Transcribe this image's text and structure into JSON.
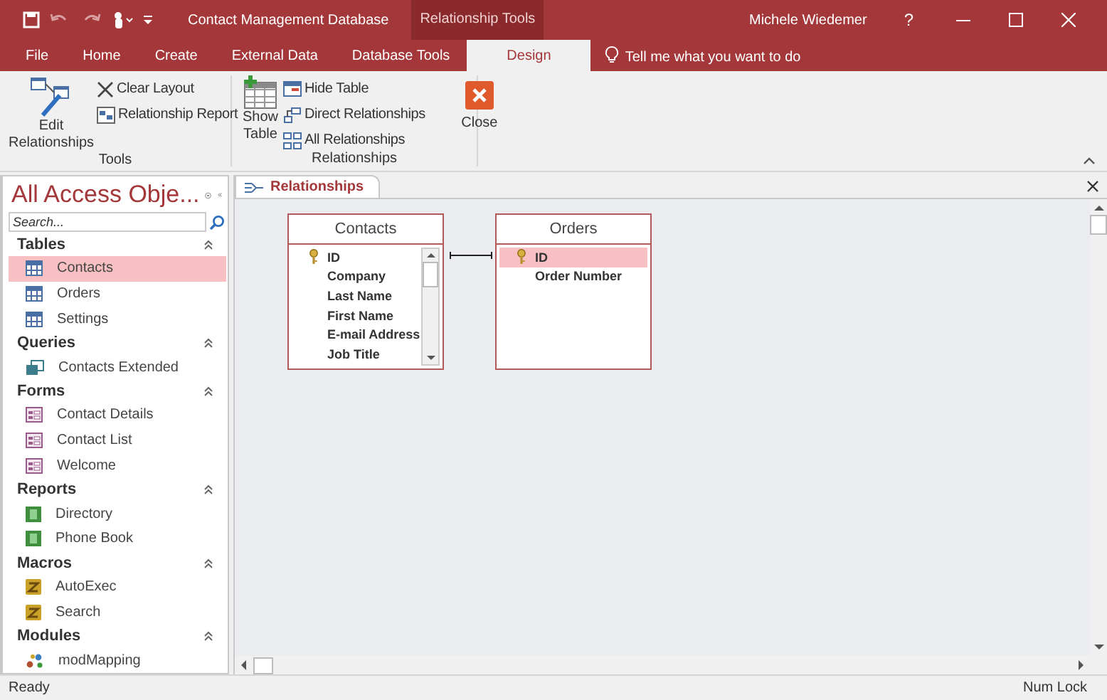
{
  "title_bar": {
    "title": "Contact Management Database",
    "context_tab": "Relationship Tools",
    "user": "Michele Wiedemer",
    "help": "?"
  },
  "tabs": [
    {
      "label": "File",
      "selected": false
    },
    {
      "label": "Home",
      "selected": false
    },
    {
      "label": "Create",
      "selected": false
    },
    {
      "label": "External Data",
      "selected": false
    },
    {
      "label": "Database Tools",
      "selected": false
    },
    {
      "label": "Design",
      "selected": true
    }
  ],
  "tell_me": {
    "placeholder": "Tell me what you want to do"
  },
  "ribbon": [
    {
      "label": "Tools",
      "buttons": [
        {
          "kind": "edit",
          "label": "Edit Relationships"
        },
        {
          "kind": "clear",
          "label": "Clear Layout"
        },
        {
          "kind": "report",
          "label": "Relationship Report"
        }
      ]
    },
    {
      "label": "Relationships",
      "buttons": [
        {
          "kind": "show",
          "label": "Show Table"
        },
        {
          "kind": "hide",
          "label": "Hide Table"
        },
        {
          "kind": "direct",
          "label": "Direct Relationships"
        },
        {
          "kind": "all",
          "label": "All Relationships"
        },
        {
          "kind": "close",
          "label": "Close"
        }
      ]
    }
  ],
  "nav_pane": {
    "title": "All Access Obje...",
    "search": {
      "placeholder": "Search..."
    },
    "groups": [
      {
        "label": "Tables",
        "items": [
          {
            "kind": "table",
            "label": "Contacts",
            "selected": true
          },
          {
            "kind": "table",
            "label": "Orders",
            "selected": false
          },
          {
            "kind": "table",
            "label": "Settings",
            "selected": false
          }
        ]
      },
      {
        "label": "Queries",
        "items": [
          {
            "kind": "query",
            "label": "Contacts Extended",
            "selected": false
          }
        ]
      },
      {
        "label": "Forms",
        "items": [
          {
            "kind": "form",
            "label": "Contact Details",
            "selected": false
          },
          {
            "kind": "form",
            "label": "Contact List",
            "selected": false
          },
          {
            "kind": "form",
            "label": "Welcome",
            "selected": false
          }
        ]
      },
      {
        "label": "Reports",
        "items": [
          {
            "kind": "report",
            "label": "Directory",
            "selected": false
          },
          {
            "kind": "report",
            "label": "Phone Book",
            "selected": false
          }
        ]
      },
      {
        "label": "Macros",
        "items": [
          {
            "kind": "macro",
            "label": "AutoExec",
            "selected": false
          },
          {
            "kind": "macro",
            "label": "Search",
            "selected": false
          }
        ]
      },
      {
        "label": "Modules",
        "items": [
          {
            "kind": "module",
            "label": "modMapping",
            "selected": false
          }
        ]
      }
    ]
  },
  "document_tab": {
    "label": "Relationships"
  },
  "tables": [
    {
      "title": "Contacts",
      "scrollbar": true,
      "fields": [
        {
          "name": "ID",
          "primary_key": true,
          "selected": false
        },
        {
          "name": "Company",
          "primary_key": false,
          "selected": false
        },
        {
          "name": "Last Name",
          "primary_key": false,
          "selected": false
        },
        {
          "name": "First Name",
          "primary_key": false,
          "selected": false
        },
        {
          "name": "E-mail Address",
          "primary_key": false,
          "selected": false
        },
        {
          "name": "Job Title",
          "primary_key": false,
          "selected": false
        }
      ]
    },
    {
      "title": "Orders",
      "scrollbar": false,
      "fields": [
        {
          "name": "ID",
          "primary_key": true,
          "selected": true
        },
        {
          "name": "Order Number",
          "primary_key": false,
          "selected": false
        }
      ]
    }
  ],
  "status_bar": {
    "left": "Ready",
    "right": "Num Lock"
  }
}
